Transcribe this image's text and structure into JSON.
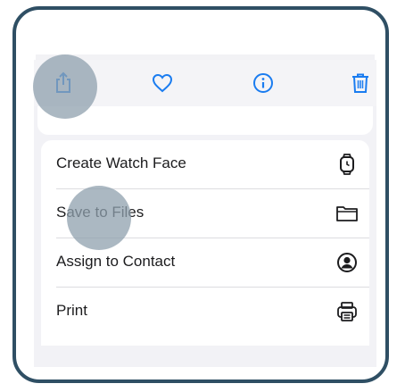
{
  "toolbar": {
    "icons": [
      "share-icon",
      "heart-icon",
      "info-icon",
      "trash-icon"
    ],
    "accent_color": "#1a7cf0"
  },
  "menu": {
    "items": [
      {
        "label": "Create Watch Face",
        "icon": "watch-icon"
      },
      {
        "label": "Save to Files",
        "icon": "folder-icon"
      },
      {
        "label": "Assign to Contact",
        "icon": "contact-icon"
      },
      {
        "label": "Print",
        "icon": "printer-icon"
      }
    ]
  },
  "frame_color": "#2f4f64"
}
